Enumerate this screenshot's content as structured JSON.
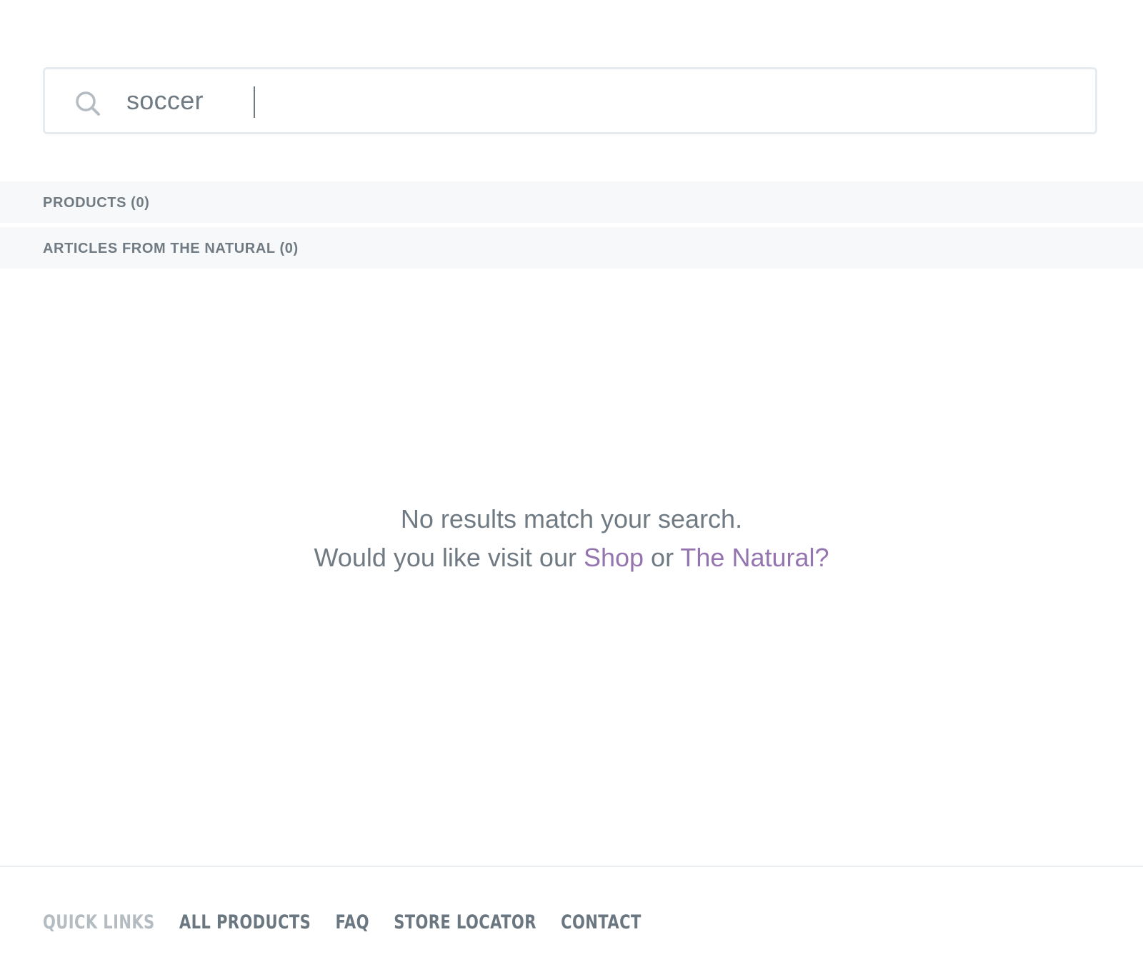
{
  "search": {
    "value": "soccer",
    "icon": "search-icon"
  },
  "categories": [
    {
      "label": "PRODUCTS (0)"
    },
    {
      "label": "ARTICLES FROM THE NATURAL (0)"
    }
  ],
  "empty_state": {
    "line1": "No results match your search.",
    "line2_prefix": "Would you like visit our ",
    "link_shop": "Shop",
    "connector": " or ",
    "link_natural": "The Natural?"
  },
  "footer": {
    "quick_links_label": "QUICK LINKS",
    "links": [
      "ALL PRODUCTS",
      "FAQ",
      "STORE LOCATOR",
      "CONTACT"
    ]
  },
  "colors": {
    "link_accent": "#9575b0",
    "text": "#6f7a83",
    "muted": "#b4bcc2",
    "row_background": "#f7f8f9"
  }
}
